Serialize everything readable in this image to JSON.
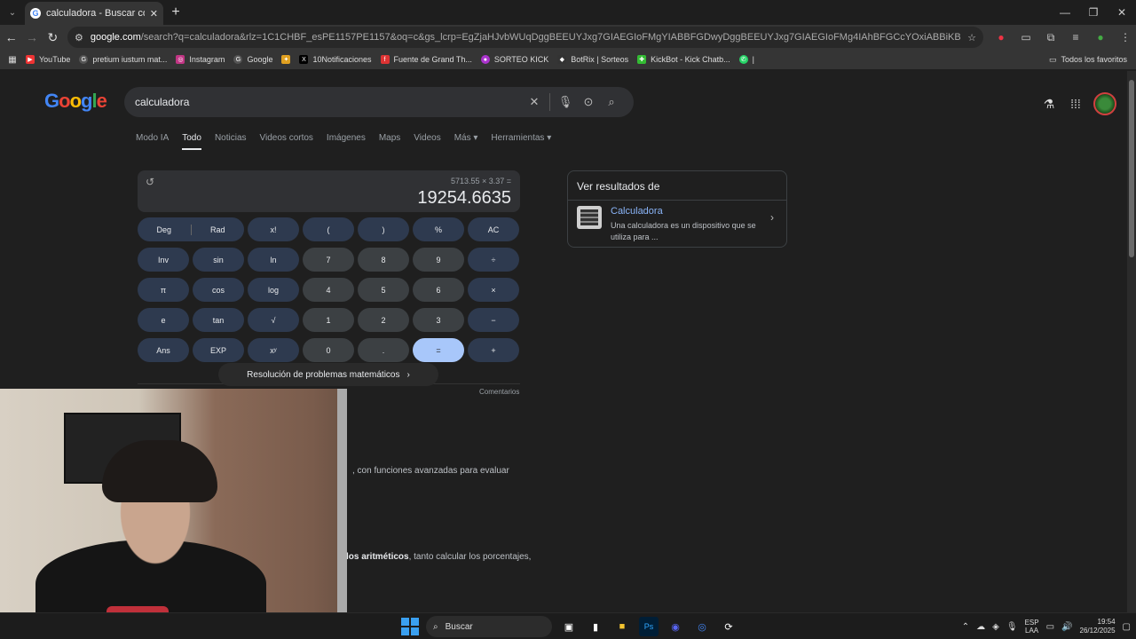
{
  "browser": {
    "tab_title": "calculadora - Buscar con Google",
    "url_host": "google.com",
    "url_rest": "/search?q=calculadora&rlz=1C1CHBF_esPE1157PE1157&oq=c&gs_lcrp=EgZjaHJvbWUqDggBEEUYJxg7GIAEGIoFMgYIABBFGDwyDggBEEUYJxg7GIAEGIoFMg4IAhBFGCcYOxiABBiKBTIGCAMQRRg7MgYIBBBFGDwyBggFEEUYPDI...",
    "bookmarks": [
      "YouTube",
      "pretium iustum mat...",
      "Instagram",
      "Google",
      "",
      "10Notificaciones",
      "Fuente de Grand Th...",
      "SORTEO KICK",
      "BotRix | Sorteos",
      "KickBot - Kick Chatb...",
      "|"
    ],
    "all_bookmarks": "Todos los favoritos"
  },
  "search": {
    "logo": "Google",
    "query": "calculadora",
    "tabs": [
      "Modo IA",
      "Todo",
      "Noticias",
      "Videos cortos",
      "Imágenes",
      "Maps",
      "Videos",
      "Más ▾",
      "Herramientas ▾"
    ]
  },
  "calculator": {
    "expression": "5713.55 × 3.37 =",
    "result": "19254.6635",
    "deg": "Deg",
    "rad": "Rad",
    "keys": [
      [
        "x!",
        "(",
        ")",
        "%",
        "AC"
      ],
      [
        "Inv",
        "sin",
        "ln",
        "7",
        "8",
        "9",
        "÷"
      ],
      [
        "π",
        "cos",
        "log",
        "4",
        "5",
        "6",
        "×"
      ],
      [
        "e",
        "tan",
        "√",
        "1",
        "2",
        "3",
        "−"
      ],
      [
        "Ans",
        "EXP",
        "xʸ",
        "0",
        ".",
        "=",
        "+"
      ]
    ],
    "math_help": "Resolución de problemas matemáticos",
    "feedback": "Comentarios"
  },
  "side_card": {
    "header": "Ver resultados de",
    "title": "Calculadora",
    "desc": "Una calculadora es un dispositivo que se utiliza para ..."
  },
  "snippets": {
    "s1": ", con funciones avanzadas para evaluar",
    "s2_bold": "los aritméticos",
    "s2_rest": ", tanto calcular los porcentajes,"
  },
  "taskbar": {
    "search": "Buscar",
    "lang1": "ESP",
    "lang2": "LAA",
    "time": "19:54",
    "date": "26/12/2025"
  },
  "colors": {
    "accent": "#a8c7fa",
    "link": "#8ab4f8",
    "bg": "#1f1f1f"
  }
}
